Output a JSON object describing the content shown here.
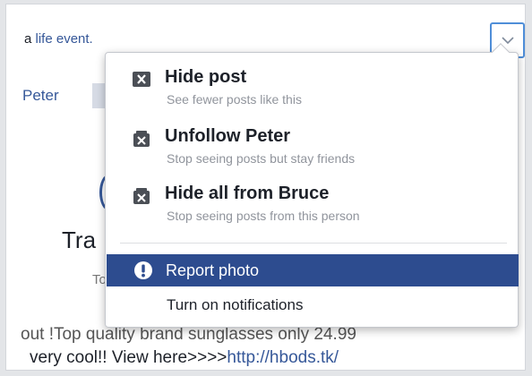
{
  "background_post": {
    "top_text_prefix": "a ",
    "top_text_link": "life event.",
    "author_link": "Peter",
    "title_fragment": "Tra",
    "subtitle_fragment": "To",
    "body_line1": "out !Top quality brand sunglasses only 24.99",
    "body_line2_text": "very cool!! View here>>>>",
    "body_line2_url": "http://hbods.tk/"
  },
  "menu": {
    "items": [
      {
        "title": "Hide post",
        "subtitle": "See fewer posts like this",
        "icon": "hide-x-icon"
      },
      {
        "title": "Unfollow Peter",
        "subtitle": "Stop seeing posts but stay friends",
        "icon": "unfollow-icon"
      },
      {
        "title": "Hide all from Bruce",
        "subtitle": "Stop seeing posts from this person",
        "icon": "hide-all-icon"
      }
    ],
    "report_label": "Report  photo",
    "notifications_label": "Turn on notifications"
  },
  "colors": {
    "link": "#365899",
    "highlight": "#2d4c8f",
    "subtitle": "#90949c"
  }
}
